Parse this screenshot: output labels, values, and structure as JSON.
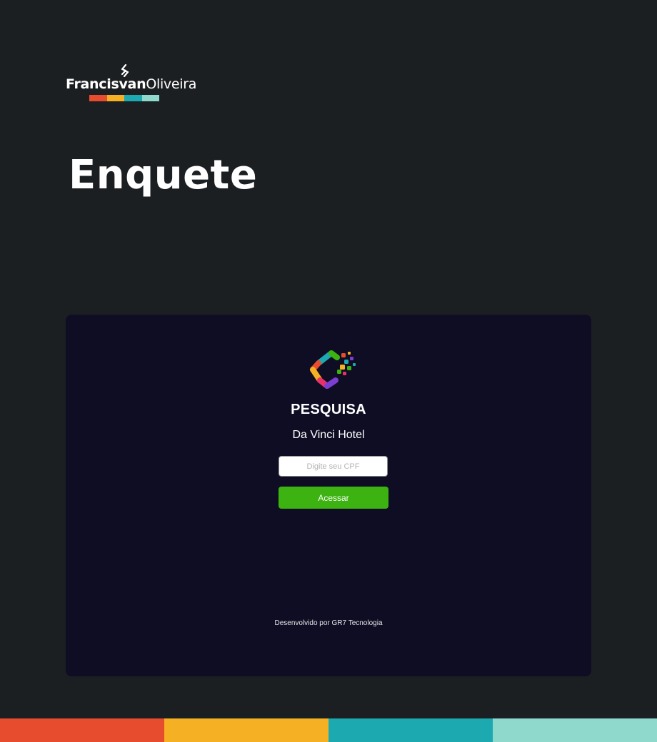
{
  "brand": {
    "first_name": "Francisvan",
    "last_name": "Oliveira",
    "icon": "arrows-logo-icon",
    "bar_colors": [
      "#e84c2e",
      "#f5b024",
      "#1ca9b0",
      "#8fd8cc"
    ]
  },
  "hero": {
    "title": "Enquete"
  },
  "app": {
    "logo_icon": "colorful-c-logo-icon",
    "title": "PESQUISA",
    "subtitle": "Da Vinci Hotel",
    "cpf_placeholder": "Digite seu CPF",
    "cpf_value": "",
    "access_label": "Acessar",
    "footer": "Desenvolvido por GR7 Tecnologia",
    "accent_color": "#3cb311",
    "background_color": "#0f0d24"
  },
  "page": {
    "background_color": "#1c1f22",
    "bottom_bar_colors": [
      "#e84c2e",
      "#f5b024",
      "#1ca9b0",
      "#8fd8cc"
    ]
  }
}
